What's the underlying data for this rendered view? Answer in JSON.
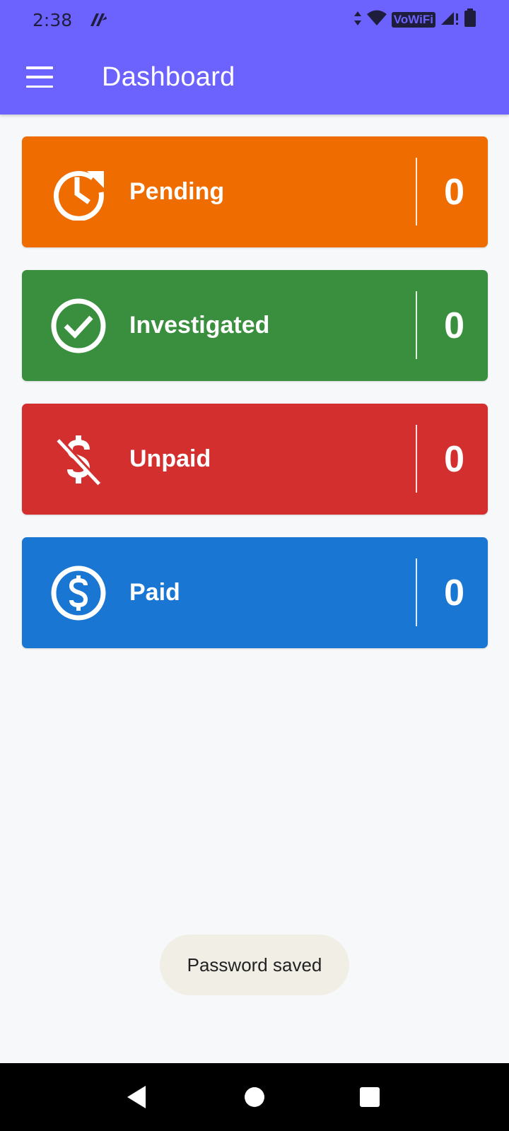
{
  "status_bar": {
    "time": "2:38",
    "network_label": "VoWiFi"
  },
  "toolbar": {
    "title": "Dashboard"
  },
  "cards": [
    {
      "label": "Pending",
      "count": "0",
      "color": "#ef6c00",
      "icon": "pending-clock-icon"
    },
    {
      "label": "Investigated",
      "count": "0",
      "color": "#3a8f3e",
      "icon": "check-circle-icon"
    },
    {
      "label": "Unpaid",
      "count": "0",
      "color": "#d32f2f",
      "icon": "money-off-icon"
    },
    {
      "label": "Paid",
      "count": "0",
      "color": "#1976d2",
      "icon": "paid-dollar-icon"
    }
  ],
  "toast": {
    "message": "Password saved"
  },
  "colors": {
    "appbar": "#6c63ff",
    "background": "#f7f8fa"
  }
}
